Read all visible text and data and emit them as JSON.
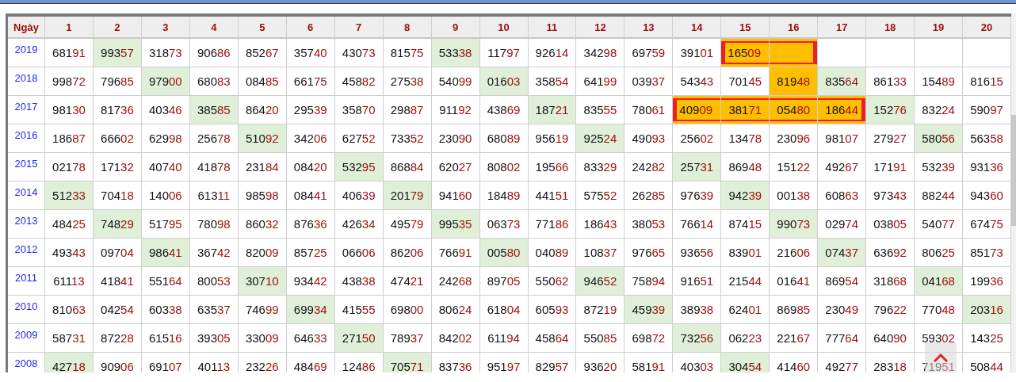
{
  "header": [
    "Ngày",
    "1",
    "2",
    "3",
    "4",
    "5",
    "6",
    "7",
    "8",
    "9",
    "10",
    "11",
    "12",
    "13",
    "14",
    "15",
    "16",
    "17",
    "18",
    "19",
    "20"
  ],
  "rows": [
    {
      "year": "2019",
      "cells": [
        {
          "value": "68191",
          "matched": false,
          "highlighted": false,
          "framed": false
        },
        {
          "value": "99357",
          "matched": true,
          "highlighted": false,
          "framed": false
        },
        {
          "value": "31873",
          "matched": false,
          "highlighted": false,
          "framed": false
        },
        {
          "value": "90686",
          "matched": false,
          "highlighted": false,
          "framed": false
        },
        {
          "value": "85267",
          "matched": false,
          "highlighted": false,
          "framed": false
        },
        {
          "value": "35740",
          "matched": false,
          "highlighted": false,
          "framed": false
        },
        {
          "value": "43073",
          "matched": false,
          "highlighted": false,
          "framed": false
        },
        {
          "value": "81575",
          "matched": false,
          "highlighted": false,
          "framed": false
        },
        {
          "value": "53338",
          "matched": true,
          "highlighted": false,
          "framed": false
        },
        {
          "value": "11797",
          "matched": false,
          "highlighted": false,
          "framed": false
        },
        {
          "value": "92614",
          "matched": false,
          "highlighted": false,
          "framed": false
        },
        {
          "value": "34298",
          "matched": false,
          "highlighted": false,
          "framed": false
        },
        {
          "value": "69759",
          "matched": false,
          "highlighted": false,
          "framed": false
        },
        {
          "value": "39101",
          "matched": false,
          "highlighted": false,
          "framed": false
        },
        {
          "value": "16509",
          "matched": false,
          "highlighted": true,
          "framed": true
        },
        {
          "matched": false,
          "highlighted": true,
          "framed": true
        },
        {
          "matched": false,
          "highlighted": false,
          "framed": false
        },
        {
          "matched": false,
          "highlighted": false,
          "framed": false
        },
        {
          "matched": false,
          "highlighted": false,
          "framed": false
        },
        {
          "matched": false,
          "highlighted": false,
          "framed": false
        }
      ]
    },
    {
      "year": "2018",
      "cells": [
        {
          "value": "99872",
          "matched": false,
          "highlighted": false,
          "framed": false
        },
        {
          "value": "79685",
          "matched": false,
          "highlighted": false,
          "framed": false
        },
        {
          "value": "97900",
          "matched": true,
          "highlighted": false,
          "framed": false
        },
        {
          "value": "68083",
          "matched": false,
          "highlighted": false,
          "framed": false
        },
        {
          "value": "08485",
          "matched": false,
          "highlighted": false,
          "framed": false
        },
        {
          "value": "66175",
          "matched": false,
          "highlighted": false,
          "framed": false
        },
        {
          "value": "45882",
          "matched": false,
          "highlighted": false,
          "framed": false
        },
        {
          "value": "27538",
          "matched": false,
          "highlighted": false,
          "framed": false
        },
        {
          "value": "54099",
          "matched": false,
          "highlighted": false,
          "framed": false
        },
        {
          "value": "01603",
          "matched": true,
          "highlighted": false,
          "framed": false
        },
        {
          "value": "35854",
          "matched": false,
          "highlighted": false,
          "framed": false
        },
        {
          "value": "64199",
          "matched": false,
          "highlighted": false,
          "framed": false
        },
        {
          "value": "03937",
          "matched": false,
          "highlighted": false,
          "framed": false
        },
        {
          "value": "54343",
          "matched": false,
          "highlighted": false,
          "framed": false
        },
        {
          "value": "70145",
          "matched": false,
          "highlighted": false,
          "framed": false
        },
        {
          "value": "81948",
          "matched": false,
          "highlighted": true,
          "framed": false
        },
        {
          "value": "83564",
          "matched": true,
          "highlighted": false,
          "framed": false
        },
        {
          "value": "86133",
          "matched": false,
          "highlighted": false,
          "framed": false
        },
        {
          "value": "15489",
          "matched": false,
          "highlighted": false,
          "framed": false
        },
        {
          "value": "81615",
          "matched": false,
          "highlighted": false,
          "framed": false
        }
      ]
    },
    {
      "year": "2017",
      "cells": [
        {
          "value": "98130",
          "matched": false,
          "highlighted": false,
          "framed": false
        },
        {
          "value": "81736",
          "matched": false,
          "highlighted": false,
          "framed": false
        },
        {
          "value": "40346",
          "matched": false,
          "highlighted": false,
          "framed": false
        },
        {
          "value": "38585",
          "matched": true,
          "highlighted": false,
          "framed": false
        },
        {
          "value": "86420",
          "matched": false,
          "highlighted": false,
          "framed": false
        },
        {
          "value": "29539",
          "matched": false,
          "highlighted": false,
          "framed": false
        },
        {
          "value": "35870",
          "matched": false,
          "highlighted": false,
          "framed": false
        },
        {
          "value": "29887",
          "matched": false,
          "highlighted": false,
          "framed": false
        },
        {
          "value": "91192",
          "matched": false,
          "highlighted": false,
          "framed": false
        },
        {
          "value": "43869",
          "matched": false,
          "highlighted": false,
          "framed": false
        },
        {
          "value": "18721",
          "matched": true,
          "highlighted": false,
          "framed": false
        },
        {
          "value": "83555",
          "matched": false,
          "highlighted": false,
          "framed": false
        },
        {
          "value": "78061",
          "matched": false,
          "highlighted": false,
          "framed": false
        },
        {
          "value": "40909",
          "matched": false,
          "highlighted": true,
          "framed": true
        },
        {
          "value": "38171",
          "matched": false,
          "highlighted": true,
          "framed": true
        },
        {
          "value": "05480",
          "matched": false,
          "highlighted": true,
          "framed": true
        },
        {
          "value": "18644",
          "matched": false,
          "highlighted": true,
          "framed": true
        },
        {
          "value": "15276",
          "matched": true,
          "highlighted": false,
          "framed": false
        },
        {
          "value": "83224",
          "matched": false,
          "highlighted": false,
          "framed": false
        },
        {
          "value": "59097",
          "matched": false,
          "highlighted": false,
          "framed": false
        }
      ]
    },
    {
      "year": "2016",
      "cells": [
        {
          "value": "18687",
          "matched": false,
          "highlighted": false,
          "framed": false
        },
        {
          "value": "66602",
          "matched": false,
          "highlighted": false,
          "framed": false
        },
        {
          "value": "62998",
          "matched": false,
          "highlighted": false,
          "framed": false
        },
        {
          "value": "25678",
          "matched": false,
          "highlighted": false,
          "framed": false
        },
        {
          "value": "51092",
          "matched": true,
          "highlighted": false,
          "framed": false
        },
        {
          "value": "34206",
          "matched": false,
          "highlighted": false,
          "framed": false
        },
        {
          "value": "62752",
          "matched": false,
          "highlighted": false,
          "framed": false
        },
        {
          "value": "73352",
          "matched": false,
          "highlighted": false,
          "framed": false
        },
        {
          "value": "23090",
          "matched": false,
          "highlighted": false,
          "framed": false
        },
        {
          "value": "68089",
          "matched": false,
          "highlighted": false,
          "framed": false
        },
        {
          "value": "95619",
          "matched": false,
          "highlighted": false,
          "framed": false
        },
        {
          "value": "92524",
          "matched": true,
          "highlighted": false,
          "framed": false
        },
        {
          "value": "49093",
          "matched": false,
          "highlighted": false,
          "framed": false
        },
        {
          "value": "25602",
          "matched": false,
          "highlighted": false,
          "framed": false
        },
        {
          "value": "13478",
          "matched": false,
          "highlighted": false,
          "framed": false
        },
        {
          "value": "23096",
          "matched": false,
          "highlighted": false,
          "framed": false
        },
        {
          "value": "98107",
          "matched": false,
          "highlighted": false,
          "framed": false
        },
        {
          "value": "27927",
          "matched": false,
          "highlighted": false,
          "framed": false
        },
        {
          "value": "58056",
          "matched": true,
          "highlighted": false,
          "framed": false
        },
        {
          "value": "56358",
          "matched": false,
          "highlighted": false,
          "framed": false
        }
      ]
    },
    {
      "year": "2015",
      "cells": [
        {
          "value": "02178",
          "matched": false,
          "highlighted": false,
          "framed": false
        },
        {
          "value": "17132",
          "matched": false,
          "highlighted": false,
          "framed": false
        },
        {
          "value": "40740",
          "matched": false,
          "highlighted": false,
          "framed": false
        },
        {
          "value": "41878",
          "matched": false,
          "highlighted": false,
          "framed": false
        },
        {
          "value": "23184",
          "matched": false,
          "highlighted": false,
          "framed": false
        },
        {
          "value": "08420",
          "matched": false,
          "highlighted": false,
          "framed": false
        },
        {
          "value": "53295",
          "matched": true,
          "highlighted": false,
          "framed": false
        },
        {
          "value": "86884",
          "matched": false,
          "highlighted": false,
          "framed": false
        },
        {
          "value": "62027",
          "matched": false,
          "highlighted": false,
          "framed": false
        },
        {
          "value": "80802",
          "matched": false,
          "highlighted": false,
          "framed": false
        },
        {
          "value": "19566",
          "matched": false,
          "highlighted": false,
          "framed": false
        },
        {
          "value": "83329",
          "matched": false,
          "highlighted": false,
          "framed": false
        },
        {
          "value": "24282",
          "matched": false,
          "highlighted": false,
          "framed": false
        },
        {
          "value": "25731",
          "matched": true,
          "highlighted": false,
          "framed": false
        },
        {
          "value": "86948",
          "matched": false,
          "highlighted": false,
          "framed": false
        },
        {
          "value": "15122",
          "matched": false,
          "highlighted": false,
          "framed": false
        },
        {
          "value": "49267",
          "matched": false,
          "highlighted": false,
          "framed": false
        },
        {
          "value": "17191",
          "matched": false,
          "highlighted": false,
          "framed": false
        },
        {
          "value": "53239",
          "matched": false,
          "highlighted": false,
          "framed": false
        },
        {
          "value": "93136",
          "matched": false,
          "highlighted": false,
          "framed": false
        }
      ]
    },
    {
      "year": "2014",
      "cells": [
        {
          "value": "51233",
          "matched": true,
          "highlighted": false,
          "framed": false
        },
        {
          "value": "70418",
          "matched": false,
          "highlighted": false,
          "framed": false
        },
        {
          "value": "14006",
          "matched": false,
          "highlighted": false,
          "framed": false
        },
        {
          "value": "61311",
          "matched": false,
          "highlighted": false,
          "framed": false
        },
        {
          "value": "98598",
          "matched": false,
          "highlighted": false,
          "framed": false
        },
        {
          "value": "08441",
          "matched": false,
          "highlighted": false,
          "framed": false
        },
        {
          "value": "40639",
          "matched": false,
          "highlighted": false,
          "framed": false
        },
        {
          "value": "20179",
          "matched": true,
          "highlighted": false,
          "framed": false
        },
        {
          "value": "94160",
          "matched": false,
          "highlighted": false,
          "framed": false
        },
        {
          "value": "18489",
          "matched": false,
          "highlighted": false,
          "framed": false
        },
        {
          "value": "44151",
          "matched": false,
          "highlighted": false,
          "framed": false
        },
        {
          "value": "57552",
          "matched": false,
          "highlighted": false,
          "framed": false
        },
        {
          "value": "26285",
          "matched": false,
          "highlighted": false,
          "framed": false
        },
        {
          "value": "97639",
          "matched": false,
          "highlighted": false,
          "framed": false
        },
        {
          "value": "94239",
          "matched": true,
          "highlighted": false,
          "framed": false
        },
        {
          "value": "00138",
          "matched": false,
          "highlighted": false,
          "framed": false
        },
        {
          "value": "60863",
          "matched": false,
          "highlighted": false,
          "framed": false
        },
        {
          "value": "97343",
          "matched": false,
          "highlighted": false,
          "framed": false
        },
        {
          "value": "88244",
          "matched": false,
          "highlighted": false,
          "framed": false
        },
        {
          "value": "94360",
          "matched": false,
          "highlighted": false,
          "framed": false
        }
      ]
    },
    {
      "year": "2013",
      "cells": [
        {
          "value": "48425",
          "matched": false,
          "highlighted": false,
          "framed": false
        },
        {
          "value": "74829",
          "matched": true,
          "highlighted": false,
          "framed": false
        },
        {
          "value": "51795",
          "matched": false,
          "highlighted": false,
          "framed": false
        },
        {
          "value": "78098",
          "matched": false,
          "highlighted": false,
          "framed": false
        },
        {
          "value": "86032",
          "matched": false,
          "highlighted": false,
          "framed": false
        },
        {
          "value": "87636",
          "matched": false,
          "highlighted": false,
          "framed": false
        },
        {
          "value": "42634",
          "matched": false,
          "highlighted": false,
          "framed": false
        },
        {
          "value": "49579",
          "matched": false,
          "highlighted": false,
          "framed": false
        },
        {
          "value": "99535",
          "matched": true,
          "highlighted": false,
          "framed": false
        },
        {
          "value": "06373",
          "matched": false,
          "highlighted": false,
          "framed": false
        },
        {
          "value": "77186",
          "matched": false,
          "highlighted": false,
          "framed": false
        },
        {
          "value": "18643",
          "matched": false,
          "highlighted": false,
          "framed": false
        },
        {
          "value": "38053",
          "matched": false,
          "highlighted": false,
          "framed": false
        },
        {
          "value": "76614",
          "matched": false,
          "highlighted": false,
          "framed": false
        },
        {
          "value": "87415",
          "matched": false,
          "highlighted": false,
          "framed": false
        },
        {
          "value": "99073",
          "matched": true,
          "highlighted": false,
          "framed": false
        },
        {
          "value": "02974",
          "matched": false,
          "highlighted": false,
          "framed": false
        },
        {
          "value": "03805",
          "matched": false,
          "highlighted": false,
          "framed": false
        },
        {
          "value": "54077",
          "matched": false,
          "highlighted": false,
          "framed": false
        },
        {
          "value": "67475",
          "matched": false,
          "highlighted": false,
          "framed": false
        }
      ]
    },
    {
      "year": "2012",
      "cells": [
        {
          "value": "49343",
          "matched": false,
          "highlighted": false,
          "framed": false
        },
        {
          "value": "09704",
          "matched": false,
          "highlighted": false,
          "framed": false
        },
        {
          "value": "98641",
          "matched": true,
          "highlighted": false,
          "framed": false
        },
        {
          "value": "36742",
          "matched": false,
          "highlighted": false,
          "framed": false
        },
        {
          "value": "82009",
          "matched": false,
          "highlighted": false,
          "framed": false
        },
        {
          "value": "85725",
          "matched": false,
          "highlighted": false,
          "framed": false
        },
        {
          "value": "06606",
          "matched": false,
          "highlighted": false,
          "framed": false
        },
        {
          "value": "86206",
          "matched": false,
          "highlighted": false,
          "framed": false
        },
        {
          "value": "76691",
          "matched": false,
          "highlighted": false,
          "framed": false
        },
        {
          "value": "00580",
          "matched": true,
          "highlighted": false,
          "framed": false
        },
        {
          "value": "04089",
          "matched": false,
          "highlighted": false,
          "framed": false
        },
        {
          "value": "10837",
          "matched": false,
          "highlighted": false,
          "framed": false
        },
        {
          "value": "97665",
          "matched": false,
          "highlighted": false,
          "framed": false
        },
        {
          "value": "93656",
          "matched": false,
          "highlighted": false,
          "framed": false
        },
        {
          "value": "83901",
          "matched": false,
          "highlighted": false,
          "framed": false
        },
        {
          "value": "21606",
          "matched": false,
          "highlighted": false,
          "framed": false
        },
        {
          "value": "07437",
          "matched": true,
          "highlighted": false,
          "framed": false
        },
        {
          "value": "63692",
          "matched": false,
          "highlighted": false,
          "framed": false
        },
        {
          "value": "80625",
          "matched": false,
          "highlighted": false,
          "framed": false
        },
        {
          "value": "85173",
          "matched": false,
          "highlighted": false,
          "framed": false
        }
      ]
    },
    {
      "year": "2011",
      "cells": [
        {
          "value": "61113",
          "matched": false,
          "highlighted": false,
          "framed": false
        },
        {
          "value": "41841",
          "matched": false,
          "highlighted": false,
          "framed": false
        },
        {
          "value": "55164",
          "matched": false,
          "highlighted": false,
          "framed": false
        },
        {
          "value": "80053",
          "matched": false,
          "highlighted": false,
          "framed": false
        },
        {
          "value": "30710",
          "matched": true,
          "highlighted": false,
          "framed": false
        },
        {
          "value": "93442",
          "matched": false,
          "highlighted": false,
          "framed": false
        },
        {
          "value": "43838",
          "matched": false,
          "highlighted": false,
          "framed": false
        },
        {
          "value": "47421",
          "matched": false,
          "highlighted": false,
          "framed": false
        },
        {
          "value": "24268",
          "matched": false,
          "highlighted": false,
          "framed": false
        },
        {
          "value": "89705",
          "matched": false,
          "highlighted": false,
          "framed": false
        },
        {
          "value": "55062",
          "matched": false,
          "highlighted": false,
          "framed": false
        },
        {
          "value": "94652",
          "matched": true,
          "highlighted": false,
          "framed": false
        },
        {
          "value": "75894",
          "matched": false,
          "highlighted": false,
          "framed": false
        },
        {
          "value": "91651",
          "matched": false,
          "highlighted": false,
          "framed": false
        },
        {
          "value": "21544",
          "matched": false,
          "highlighted": false,
          "framed": false
        },
        {
          "value": "01641",
          "matched": false,
          "highlighted": false,
          "framed": false
        },
        {
          "value": "86954",
          "matched": false,
          "highlighted": false,
          "framed": false
        },
        {
          "value": "31868",
          "matched": false,
          "highlighted": false,
          "framed": false
        },
        {
          "value": "04168",
          "matched": true,
          "highlighted": false,
          "framed": false
        },
        {
          "value": "19936",
          "matched": false,
          "highlighted": false,
          "framed": false
        }
      ]
    },
    {
      "year": "2010",
      "cells": [
        {
          "value": "81063",
          "matched": false,
          "highlighted": false,
          "framed": false
        },
        {
          "value": "04254",
          "matched": false,
          "highlighted": false,
          "framed": false
        },
        {
          "value": "60338",
          "matched": false,
          "highlighted": false,
          "framed": false
        },
        {
          "value": "63537",
          "matched": false,
          "highlighted": false,
          "framed": false
        },
        {
          "value": "74699",
          "matched": false,
          "highlighted": false,
          "framed": false
        },
        {
          "value": "69934",
          "matched": true,
          "highlighted": false,
          "framed": false
        },
        {
          "value": "41555",
          "matched": false,
          "highlighted": false,
          "framed": false
        },
        {
          "value": "69800",
          "matched": false,
          "highlighted": false,
          "framed": false
        },
        {
          "value": "80624",
          "matched": false,
          "highlighted": false,
          "framed": false
        },
        {
          "value": "61804",
          "matched": false,
          "highlighted": false,
          "framed": false
        },
        {
          "value": "60593",
          "matched": false,
          "highlighted": false,
          "framed": false
        },
        {
          "value": "87219",
          "matched": false,
          "highlighted": false,
          "framed": false
        },
        {
          "value": "45939",
          "matched": true,
          "highlighted": false,
          "framed": false
        },
        {
          "value": "38938",
          "matched": false,
          "highlighted": false,
          "framed": false
        },
        {
          "value": "62401",
          "matched": false,
          "highlighted": false,
          "framed": false
        },
        {
          "value": "86985",
          "matched": false,
          "highlighted": false,
          "framed": false
        },
        {
          "value": "23049",
          "matched": false,
          "highlighted": false,
          "framed": false
        },
        {
          "value": "79622",
          "matched": false,
          "highlighted": false,
          "framed": false
        },
        {
          "value": "77048",
          "matched": false,
          "highlighted": false,
          "framed": false
        },
        {
          "value": "20316",
          "matched": true,
          "highlighted": false,
          "framed": false
        }
      ]
    },
    {
      "year": "2009",
      "cells": [
        {
          "value": "58731",
          "matched": false,
          "highlighted": false,
          "framed": false
        },
        {
          "value": "87228",
          "matched": false,
          "highlighted": false,
          "framed": false
        },
        {
          "value": "61516",
          "matched": false,
          "highlighted": false,
          "framed": false
        },
        {
          "value": "39305",
          "matched": false,
          "highlighted": false,
          "framed": false
        },
        {
          "value": "33009",
          "matched": false,
          "highlighted": false,
          "framed": false
        },
        {
          "value": "64633",
          "matched": false,
          "highlighted": false,
          "framed": false
        },
        {
          "value": "27150",
          "matched": true,
          "highlighted": false,
          "framed": false
        },
        {
          "value": "78937",
          "matched": false,
          "highlighted": false,
          "framed": false
        },
        {
          "value": "84202",
          "matched": false,
          "highlighted": false,
          "framed": false
        },
        {
          "value": "61194",
          "matched": false,
          "highlighted": false,
          "framed": false
        },
        {
          "value": "45864",
          "matched": false,
          "highlighted": false,
          "framed": false
        },
        {
          "value": "55085",
          "matched": false,
          "highlighted": false,
          "framed": false
        },
        {
          "value": "69872",
          "matched": false,
          "highlighted": false,
          "framed": false
        },
        {
          "value": "73256",
          "matched": true,
          "highlighted": false,
          "framed": false
        },
        {
          "value": "06223",
          "matched": false,
          "highlighted": false,
          "framed": false
        },
        {
          "value": "22167",
          "matched": false,
          "highlighted": false,
          "framed": false
        },
        {
          "value": "77764",
          "matched": false,
          "highlighted": false,
          "framed": false
        },
        {
          "value": "64090",
          "matched": false,
          "highlighted": false,
          "framed": false
        },
        {
          "value": "59302",
          "matched": false,
          "highlighted": false,
          "framed": false
        },
        {
          "value": "14325",
          "matched": false,
          "highlighted": false,
          "framed": false
        }
      ]
    },
    {
      "year": "2008",
      "cells": [
        {
          "value": "42718",
          "matched": true,
          "highlighted": false,
          "framed": false
        },
        {
          "value": "90906",
          "matched": false,
          "highlighted": false,
          "framed": false
        },
        {
          "value": "69107",
          "matched": false,
          "highlighted": false,
          "framed": false
        },
        {
          "value": "40113",
          "matched": false,
          "highlighted": false,
          "framed": false
        },
        {
          "value": "23226",
          "matched": false,
          "highlighted": false,
          "framed": false
        },
        {
          "value": "48469",
          "matched": false,
          "highlighted": false,
          "framed": false
        },
        {
          "value": "12486",
          "matched": false,
          "highlighted": false,
          "framed": false
        },
        {
          "value": "70571",
          "matched": true,
          "highlighted": false,
          "framed": false
        },
        {
          "value": "83736",
          "matched": false,
          "highlighted": false,
          "framed": false
        },
        {
          "value": "95197",
          "matched": false,
          "highlighted": false,
          "framed": false
        },
        {
          "value": "82957",
          "matched": false,
          "highlighted": false,
          "framed": false
        },
        {
          "value": "93620",
          "matched": false,
          "highlighted": false,
          "framed": false
        },
        {
          "value": "58191",
          "matched": false,
          "highlighted": false,
          "framed": false
        },
        {
          "value": "40303",
          "matched": false,
          "highlighted": false,
          "framed": false
        },
        {
          "value": "30454",
          "matched": true,
          "highlighted": false,
          "framed": false
        },
        {
          "value": "41460",
          "matched": false,
          "highlighted": false,
          "framed": false
        },
        {
          "value": "49277",
          "matched": false,
          "highlighted": false,
          "framed": false
        },
        {
          "value": "28318",
          "matched": false,
          "highlighted": false,
          "framed": false
        },
        {
          "value": "71951",
          "matched": false,
          "highlighted": false,
          "framed": false
        },
        {
          "value": "50844",
          "matched": false,
          "highlighted": false,
          "framed": false
        }
      ]
    }
  ]
}
